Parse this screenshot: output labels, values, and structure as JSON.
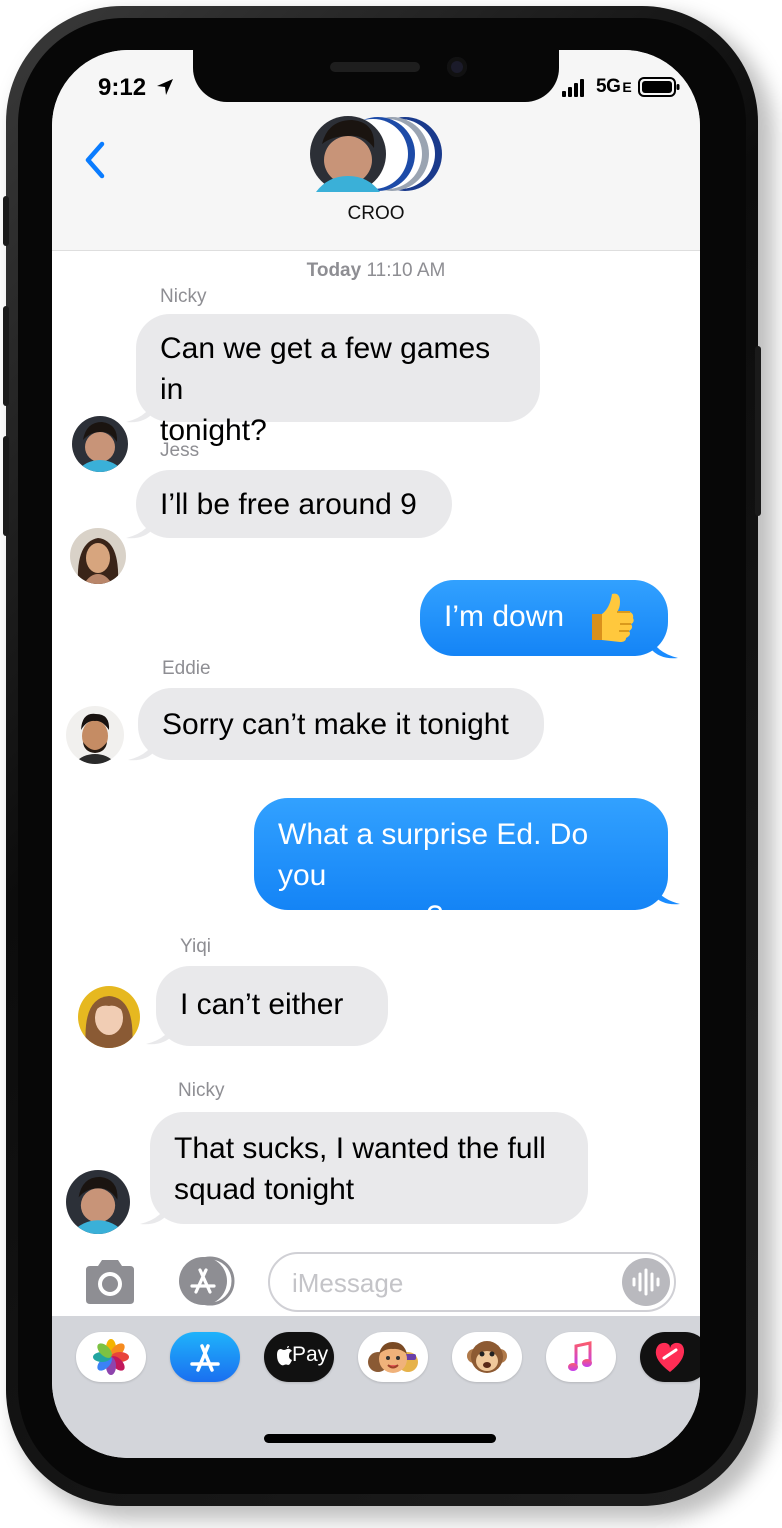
{
  "status": {
    "time": "9:12",
    "network": "5G",
    "network_suffix": "E"
  },
  "header": {
    "group_name": "CROO"
  },
  "timestamp": {
    "day": "Today",
    "time": "11:10 AM"
  },
  "messages": [
    {
      "sender": "Nicky",
      "direction": "incoming",
      "lines": [
        "Can we get a few games in",
        "tonight?"
      ]
    },
    {
      "sender": "Jess",
      "direction": "incoming",
      "lines": [
        "I’ll be free around 9"
      ]
    },
    {
      "sender": "",
      "direction": "outgoing",
      "lines": [
        "I’m down"
      ],
      "emoji": "thumbs-up"
    },
    {
      "sender": "Eddie",
      "direction": "incoming",
      "lines": [
        "Sorry can’t make it tonight"
      ]
    },
    {
      "sender": "",
      "direction": "outgoing",
      "lines": [
        "What a surprise Ed. Do you",
        "even game?"
      ]
    },
    {
      "sender": "Yiqi",
      "direction": "incoming",
      "lines": [
        "I can’t either"
      ]
    },
    {
      "sender": "Nicky",
      "direction": "incoming",
      "lines": [
        "That sucks, I wanted the full",
        "squad tonight"
      ]
    }
  ],
  "composer": {
    "placeholder": "iMessage",
    "value": ""
  },
  "app_drawer": {
    "items": [
      {
        "icon": "photos-icon"
      },
      {
        "icon": "app-store-icon"
      },
      {
        "icon": "apple-pay-icon",
        "label": "Pay"
      },
      {
        "icon": "memoji-icon"
      },
      {
        "icon": "animoji-monkey-icon"
      },
      {
        "icon": "music-icon"
      },
      {
        "icon": "digital-touch-icon"
      }
    ]
  },
  "colors": {
    "outgoing_bubble": "#1a8cff",
    "incoming_bubble": "#e9e9eb",
    "accent": "#0a7cff",
    "header_bg": "#f6f6f6",
    "drawer_bg": "#d3d5da"
  }
}
